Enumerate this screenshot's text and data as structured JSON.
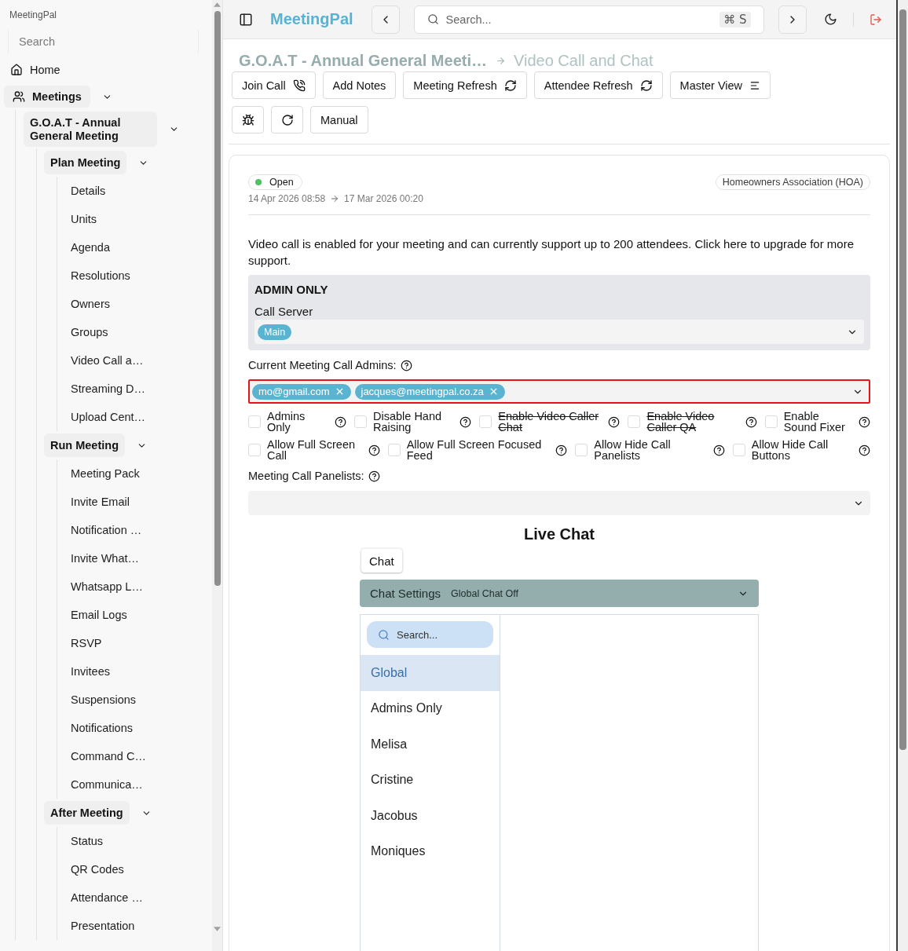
{
  "sidebar": {
    "brand": "MeetingPal",
    "search": {
      "placeholder": "Search"
    },
    "items": [
      {
        "label": "Home"
      },
      {
        "label": "Meetings",
        "expanded": true,
        "children": [
          {
            "label": "G.O.A.T - Annual General Meeting",
            "expanded": true,
            "children": [
              {
                "label": "Plan Meeting",
                "expanded": true,
                "children": [
                  {
                    "label": "Details"
                  },
                  {
                    "label": "Units"
                  },
                  {
                    "label": "Agenda"
                  },
                  {
                    "label": "Resolutions"
                  },
                  {
                    "label": "Owners"
                  },
                  {
                    "label": "Groups"
                  },
                  {
                    "label": "Video Call a…"
                  },
                  {
                    "label": "Streaming D…"
                  },
                  {
                    "label": "Upload Cent…"
                  }
                ]
              },
              {
                "label": "Run Meeting",
                "expanded": true,
                "children": [
                  {
                    "label": "Meeting Pack"
                  },
                  {
                    "label": "Invite Email"
                  },
                  {
                    "label": "Notification …"
                  },
                  {
                    "label": "Invite What…"
                  },
                  {
                    "label": "Whatsapp L…"
                  },
                  {
                    "label": "Email Logs"
                  },
                  {
                    "label": "RSVP"
                  },
                  {
                    "label": "Invitees"
                  },
                  {
                    "label": "Suspensions"
                  },
                  {
                    "label": "Notifications"
                  },
                  {
                    "label": "Command C…"
                  },
                  {
                    "label": "Communica…"
                  }
                ]
              },
              {
                "label": "After Meeting",
                "expanded": true,
                "children": [
                  {
                    "label": "Status"
                  },
                  {
                    "label": "QR Codes"
                  },
                  {
                    "label": "Attendance …"
                  },
                  {
                    "label": "Presentation"
                  }
                ]
              }
            ]
          }
        ]
      }
    ]
  },
  "topbar": {
    "brand": "MeetingPal",
    "search": {
      "placeholder": "Search...",
      "shortcut": "⌘ S"
    }
  },
  "breadcrumb": {
    "parent": "G.O.A.T - Annual General Meeti…",
    "current": "Video Call and Chat"
  },
  "toolbar": {
    "actions": [
      {
        "label": "Join Call",
        "kind": "call"
      },
      {
        "label": "Add Notes",
        "kind": "plain"
      },
      {
        "label": "Meeting Refresh",
        "kind": "refresh"
      },
      {
        "label": "Attendee Refresh",
        "kind": "refresh"
      },
      {
        "label": "Master View",
        "kind": "list"
      }
    ],
    "extra_actions": [
      "Manual"
    ]
  },
  "meeting": {
    "status": {
      "label": "Open",
      "color": "#4cc264"
    },
    "category": "Homeowners Association (HOA)",
    "start": "14 Apr 2026 08:58",
    "end": "17 Mar 2026 00:20"
  },
  "notice": "Video call is enabled for your meeting and can currently support up to 200 attendees. Click here to upgrade for more support.",
  "admin_section": {
    "title": "ADMIN ONLY",
    "call_server": {
      "label": "Call Server",
      "value": "Main"
    }
  },
  "call_admins": {
    "label": "Current Meeting Call Admins:",
    "values": [
      "mo@gmail.com",
      "jacques@meetingpal.co.za"
    ],
    "highlighted": true
  },
  "options": [
    {
      "label": "Admins Only",
      "checked": false,
      "deprecated": false
    },
    {
      "label": "Disable Hand Raising",
      "checked": false,
      "deprecated": false
    },
    {
      "label": "Enable Video Caller Chat",
      "checked": false,
      "deprecated": true
    },
    {
      "label": "Enable Video Caller QA",
      "checked": false,
      "deprecated": true
    },
    {
      "label": "Enable Sound Fixer",
      "checked": false,
      "deprecated": false
    },
    {
      "label": "Allow Full Screen Call",
      "checked": false,
      "deprecated": false
    },
    {
      "label": "Allow Full Screen Focused Feed",
      "checked": false,
      "deprecated": false
    },
    {
      "label": "Allow Hide Call Panelists",
      "checked": false,
      "deprecated": false
    },
    {
      "label": "Allow Hide Call Buttons",
      "checked": false,
      "deprecated": false
    }
  ],
  "panelists": {
    "label": "Meeting Call Panelists:"
  },
  "live_chat": {
    "title": "Live Chat",
    "tabs": [
      {
        "label": "Chat",
        "selected": true
      }
    ],
    "settings": {
      "label": "Chat Settings",
      "value": "Global Chat Off"
    },
    "search": {
      "placeholder": "Search..."
    },
    "conversations": [
      {
        "label": "Global",
        "selected": true
      },
      {
        "label": "Admins Only",
        "selected": false
      },
      {
        "label": "Melisa",
        "selected": false
      },
      {
        "label": "Cristine",
        "selected": false
      },
      {
        "label": "Jacobus",
        "selected": false
      },
      {
        "label": "Moniques",
        "selected": false
      }
    ]
  }
}
